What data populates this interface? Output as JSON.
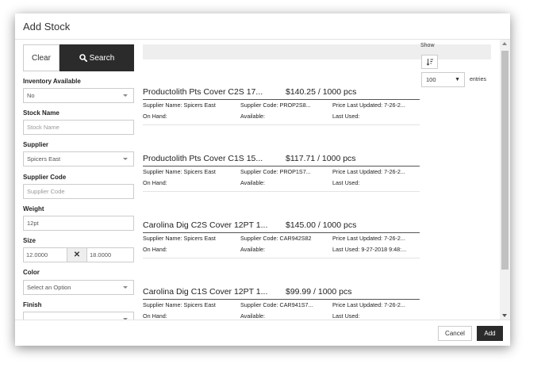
{
  "modal": {
    "title": "Add Stock"
  },
  "sidebar": {
    "clear_label": "Clear",
    "search_label": "Search",
    "inventory": {
      "label": "Inventory Available",
      "value": "No"
    },
    "stock_name": {
      "label": "Stock Name",
      "placeholder": "Stock Name"
    },
    "supplier": {
      "label": "Supplier",
      "value": "Spicers East"
    },
    "supplier_code": {
      "label": "Supplier Code",
      "placeholder": "Supplier Code"
    },
    "weight": {
      "label": "Weight",
      "value": "12pt"
    },
    "size": {
      "label": "Size",
      "width": "12.0000",
      "height": "18.0000",
      "separator": "✕"
    },
    "color": {
      "label": "Color",
      "value": "Select an Option"
    },
    "finish": {
      "label": "Finish",
      "value": ""
    }
  },
  "table": {
    "show_label": "Show",
    "entries_value": "100",
    "entries_label": "entries"
  },
  "items": [
    {
      "name": "Productolith Pts Cover C2S 17...",
      "price": "$140.25 / 1000 pcs",
      "supplier_name": "Supplier Name: Spicers East",
      "supplier_code": "Supplier Code: PROP2S8...",
      "price_updated": "Price Last Updated: 7-26-2...",
      "on_hand": "On Hand:",
      "available": "Available:",
      "last_used": "Last Used:"
    },
    {
      "name": "Productolith Pts Cover C1S 15...",
      "price": "$117.71 / 1000 pcs",
      "supplier_name": "Supplier Name: Spicers East",
      "supplier_code": "Supplier Code: PROP1S7...",
      "price_updated": "Price Last Updated: 7-26-2...",
      "on_hand": "On Hand:",
      "available": "Available:",
      "last_used": "Last Used:"
    },
    {
      "name": "Carolina Dig C2S Cover 12PT 1...",
      "price": "$145.00 / 1000 pcs",
      "supplier_name": "Supplier Name: Spicers East",
      "supplier_code": "Supplier Code: CAR942S82",
      "price_updated": "Price Last Updated: 7-26-2...",
      "on_hand": "On Hand:",
      "available": "Available:",
      "last_used": "Last Used: 9-27-2018 9:48:..."
    },
    {
      "name": "Carolina Dig C1S Cover 12PT 1...",
      "price": "$99.99 / 1000 pcs",
      "supplier_name": "Supplier Name: Spicers East",
      "supplier_code": "Supplier Code: CAR941S7...",
      "price_updated": "Price Last Updated: 7-26-2...",
      "on_hand": "On Hand:",
      "available": "Available:",
      "last_used": "Last Used:"
    }
  ],
  "footer": {
    "cancel_label": "Cancel",
    "add_label": "Add"
  }
}
